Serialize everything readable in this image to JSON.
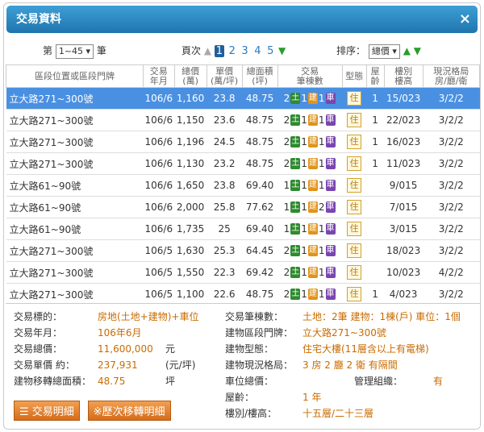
{
  "dialog": {
    "title": "交易資料",
    "close": "×"
  },
  "toolbar": {
    "page_prefix": "第",
    "page_range": "1~45 ▾",
    "page_suffix": "筆",
    "pages_label": "頁次",
    "pages": [
      "1",
      "2",
      "3",
      "4",
      "5"
    ],
    "sort_label": "排序：",
    "sort_value": "總價 ▾"
  },
  "table": {
    "headers": [
      "區段位置或區段門牌",
      "交易\n年月",
      "總價\n(萬)",
      "單價\n(萬/坪)",
      "總面積\n(坪)",
      "交易\n筆棟數",
      "型態",
      "屋\n齡",
      "樓別\n樓高",
      "現況格局\n房/廳/衛"
    ],
    "rows": [
      {
        "addr": "立大路271~300號",
        "ym": "106/6",
        "total": "1,160",
        "unit": "23.8",
        "area": "48.75",
        "land": "2",
        "bld": "1",
        "car": "1",
        "type": "住",
        "age": "1",
        "floor": "15/023",
        "layout": "3/2/2"
      },
      {
        "addr": "立大路271~300號",
        "ym": "106/6",
        "total": "1,150",
        "unit": "23.6",
        "area": "48.75",
        "land": "2",
        "bld": "1",
        "car": "1",
        "type": "住",
        "age": "1",
        "floor": "22/023",
        "layout": "3/2/2"
      },
      {
        "addr": "立大路271~300號",
        "ym": "106/6",
        "total": "1,196",
        "unit": "24.5",
        "area": "48.75",
        "land": "2",
        "bld": "1",
        "car": "1",
        "type": "住",
        "age": "1",
        "floor": "16/023",
        "layout": "3/2/2"
      },
      {
        "addr": "立大路271~300號",
        "ym": "106/6",
        "total": "1,130",
        "unit": "23.2",
        "area": "48.75",
        "land": "2",
        "bld": "1",
        "car": "1",
        "type": "住",
        "age": "1",
        "floor": "11/023",
        "layout": "3/2/2"
      },
      {
        "addr": "立大路61~90號",
        "ym": "106/6",
        "total": "1,650",
        "unit": "23.8",
        "area": "69.40",
        "land": "1",
        "bld": "1",
        "car": "1",
        "type": "住",
        "age": "",
        "floor": "9/015",
        "layout": "3/2/2"
      },
      {
        "addr": "立大路61~90號",
        "ym": "106/6",
        "total": "2,000",
        "unit": "25.8",
        "area": "77.62",
        "land": "1",
        "bld": "1",
        "car": "2",
        "type": "住",
        "age": "",
        "floor": "7/015",
        "layout": "3/2/2"
      },
      {
        "addr": "立大路61~90號",
        "ym": "106/6",
        "total": "1,735",
        "unit": "25",
        "area": "69.40",
        "land": "1",
        "bld": "1",
        "car": "1",
        "type": "住",
        "age": "",
        "floor": "3/015",
        "layout": "3/2/2"
      },
      {
        "addr": "立大路271~300號",
        "ym": "106/5",
        "total": "1,630",
        "unit": "25.3",
        "area": "64.45",
        "land": "2",
        "bld": "1",
        "car": "1",
        "type": "住",
        "age": "",
        "floor": "18/023",
        "layout": "3/2/2"
      },
      {
        "addr": "立大路271~300號",
        "ym": "106/5",
        "total": "1,550",
        "unit": "22.3",
        "area": "69.42",
        "land": "2",
        "bld": "1",
        "car": "1",
        "type": "住",
        "age": "",
        "floor": "10/023",
        "layout": "4/2/2"
      },
      {
        "addr": "立大路271~300號",
        "ym": "106/5",
        "total": "1,100",
        "unit": "22.6",
        "area": "48.75",
        "land": "2",
        "bld": "1",
        "car": "1",
        "type": "住",
        "age": "1",
        "floor": "4/023",
        "layout": "3/2/2"
      }
    ],
    "tag_labels": {
      "land": "土",
      "bld": "建",
      "car": "車"
    }
  },
  "details": {
    "left": [
      {
        "k": "交易標的：",
        "v": "房地(土地+建物)+車位",
        "u": ""
      },
      {
        "k": "交易年月：",
        "v": "106年6月",
        "u": ""
      },
      {
        "k": "交易總價：",
        "v": "11,600,000",
        "u": "元"
      },
      {
        "k": "交易單價 約：",
        "v": "237,931",
        "u": "(元/坪)"
      },
      {
        "k": "建物移轉總面積：",
        "v": "48.75",
        "u": "坪"
      }
    ],
    "right": [
      {
        "k": "交易筆棟數：",
        "v": "土地：2筆 建物：1棟(戶) 車位：1個"
      },
      {
        "k": "建物區段門牌：",
        "v": "立大路271~300號"
      },
      {
        "k": "建物型態：",
        "v": "住宅大樓(11層含以上有電梯)"
      },
      {
        "k": "建物現況格局：",
        "v": "3 房 2 廳 2 衛 有隔間"
      },
      {
        "k": "車位總價：",
        "v": "管理組織：",
        "v2": "有"
      },
      {
        "k": "屋齡：",
        "v": "1 年"
      },
      {
        "k": "樓別/樓高：",
        "v": "十五層/二十三層"
      }
    ],
    "buttons": [
      "☰ 交易明細",
      "※歷次移轉明細"
    ]
  }
}
